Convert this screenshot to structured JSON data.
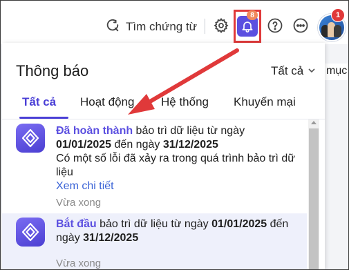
{
  "header": {
    "search_label": "Tìm chứng từ",
    "notification_count": "8",
    "avatar_badge_count": "1"
  },
  "background": {
    "partial_text": "mục"
  },
  "panel": {
    "title": "Thông báo",
    "filter_label": "Tất cả",
    "tabs": [
      {
        "label": "Tất cả",
        "active": true
      },
      {
        "label": "Hoạt động",
        "active": false
      },
      {
        "label": "Hệ thống",
        "active": false
      },
      {
        "label": "Khuyến mại",
        "active": false
      }
    ],
    "notifications": [
      {
        "status": "Đã hoàn thành",
        "text_1": " bảo trì dữ liệu từ ngày",
        "date_from": "01/01/2025",
        "text_2": " đến ngày ",
        "date_to": "31/12/2025",
        "detail": "Có một số lỗi đã xảy ra trong quá trình bảo trì dữ liệu",
        "link": "Xem chi tiết",
        "time": "Vừa xong"
      },
      {
        "status": "Bắt đầu",
        "text_1": " bảo trì dữ liệu từ ngày ",
        "date_from": "01/01/2025",
        "text_2": " đến ngày ",
        "date_to": "31/12/2025",
        "time": "Vừa xong"
      }
    ]
  },
  "colors": {
    "accent": "#4a3fd6",
    "highlight_box": "#e0393a",
    "badge_orange": "#f08a5d",
    "link": "#3a63d6"
  },
  "icons": [
    "search-icon",
    "settings-gear-icon",
    "bell-icon",
    "help-icon",
    "more-icon",
    "chevron-down-icon",
    "app-logo-icon"
  ]
}
